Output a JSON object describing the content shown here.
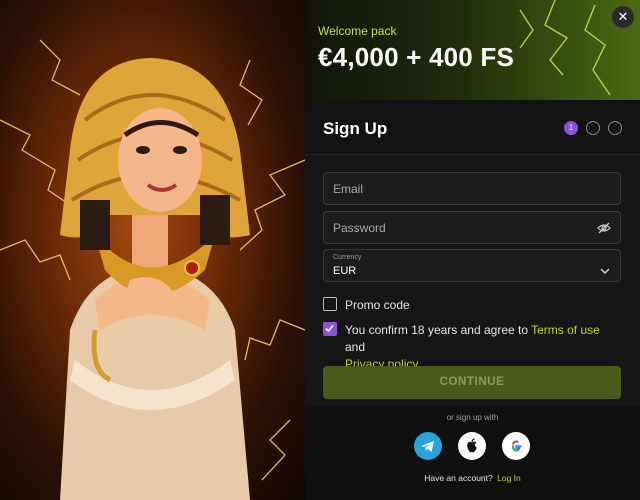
{
  "banner": {
    "welcome_label": "Welcome pack",
    "bonus_text": "€4,000 + 400 FS",
    "close_symbol": "✕"
  },
  "signup": {
    "title": "Sign Up",
    "steps": [
      "1",
      "",
      ""
    ],
    "active_step": 1
  },
  "form": {
    "email_placeholder": "Email",
    "password_placeholder": "Password",
    "currency_label": "Currency",
    "currency_value": "EUR",
    "promo_label": "Promo code",
    "promo_checked": false,
    "terms_prefix": "You confirm 18 years and agree to ",
    "terms_link": "Terms of use",
    "terms_and": " and",
    "privacy_link": "Privacy policy",
    "terms_checked": true,
    "continue_label": "CONTINUE"
  },
  "social": {
    "or_text": "or sign up with",
    "providers": [
      "telegram-icon",
      "apple-icon",
      "google-icon"
    ]
  },
  "footer": {
    "have_account": "Have an account?",
    "login_link": "Log In"
  },
  "colors": {
    "accent_purple": "#8e4fe0",
    "accent_green": "#b7d83e",
    "button_bg": "#4a5a1a",
    "telegram": "#2aa3dc"
  }
}
